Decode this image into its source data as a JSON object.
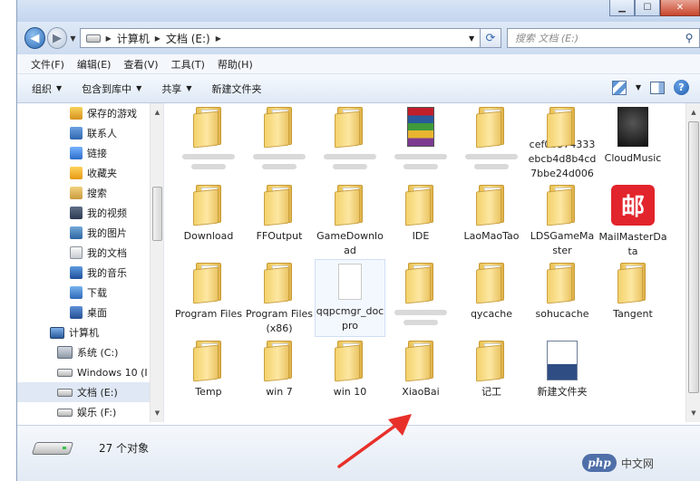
{
  "window": {
    "buttons": {
      "minimize": "▁",
      "maximize": "☐",
      "close": "✕"
    }
  },
  "address": {
    "crumbs": [
      "计算机",
      "文档 (E:)"
    ],
    "search_placeholder": "搜索 文档 (E:)"
  },
  "menu": [
    "文件(F)",
    "编辑(E)",
    "查看(V)",
    "工具(T)",
    "帮助(H)"
  ],
  "toolbar": {
    "organize": "组织",
    "include": "包含到库中",
    "share": "共享",
    "new_folder": "新建文件夹"
  },
  "nav": [
    {
      "label": "保存的游戏",
      "icon": "game"
    },
    {
      "label": "联系人",
      "icon": "contact"
    },
    {
      "label": "链接",
      "icon": "link"
    },
    {
      "label": "收藏夹",
      "icon": "star"
    },
    {
      "label": "搜索",
      "icon": "search"
    },
    {
      "label": "我的视频",
      "icon": "video"
    },
    {
      "label": "我的图片",
      "icon": "pic"
    },
    {
      "label": "我的文档",
      "icon": "doc"
    },
    {
      "label": "我的音乐",
      "icon": "music"
    },
    {
      "label": "下载",
      "icon": "down"
    },
    {
      "label": "桌面",
      "icon": "desk"
    },
    {
      "label": "计算机",
      "icon": "comp"
    },
    {
      "label": "系统 (C:)",
      "icon": "sys"
    },
    {
      "label": "Windows 10 (I",
      "icon": "drv"
    },
    {
      "label": "文档 (E:)",
      "icon": "drv"
    },
    {
      "label": "娱乐 (F:)",
      "icon": "drv"
    }
  ],
  "items": [
    {
      "label": "",
      "kind": "folder"
    },
    {
      "label": "",
      "kind": "folder"
    },
    {
      "label": "",
      "kind": "folder"
    },
    {
      "label": "",
      "kind": "winrar"
    },
    {
      "label": "",
      "kind": "folder"
    },
    {
      "label": "cef0b574333ebcb4d8b4cd7bbe24d006",
      "kind": "folder"
    },
    {
      "label": "CloudMusic",
      "kind": "cloud"
    },
    {
      "label": "Download",
      "kind": "folder"
    },
    {
      "label": "FFOutput",
      "kind": "folder"
    },
    {
      "label": "GameDownload",
      "kind": "folder"
    },
    {
      "label": "IDE",
      "kind": "folder"
    },
    {
      "label": "LaoMaoTao",
      "kind": "folder"
    },
    {
      "label": "LDSGameMaster",
      "kind": "folder"
    },
    {
      "label": "MailMasterData",
      "kind": "mail"
    },
    {
      "label": "Program Files",
      "kind": "folder"
    },
    {
      "label": "Program Files (x86)",
      "kind": "folder"
    },
    {
      "label": "qqpcmgr_docpro",
      "kind": "doc"
    },
    {
      "label": "",
      "kind": "folder"
    },
    {
      "label": "qycache",
      "kind": "folder"
    },
    {
      "label": "sohucache",
      "kind": "folder"
    },
    {
      "label": "Tangent",
      "kind": "folder"
    },
    {
      "label": "Temp",
      "kind": "folder"
    },
    {
      "label": "win 7",
      "kind": "folder"
    },
    {
      "label": "win 10",
      "kind": "folder"
    },
    {
      "label": "XiaoBai",
      "kind": "folder"
    },
    {
      "label": "记工",
      "kind": "folder"
    },
    {
      "label": "新建文件夹",
      "kind": "news"
    }
  ],
  "status": {
    "count": "27 个对象"
  },
  "watermark": {
    "logo": "php",
    "text": "中文网"
  },
  "mail_glyph": "邮"
}
